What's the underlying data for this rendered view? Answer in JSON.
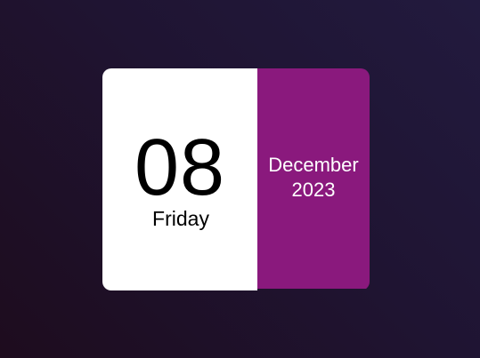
{
  "calendar": {
    "day_number": "08",
    "weekday": "Friday",
    "month": "December",
    "year": "2023"
  },
  "colors": {
    "day_panel": "#ffffff",
    "month_panel": "#8a197d",
    "background": "#1f1432"
  }
}
